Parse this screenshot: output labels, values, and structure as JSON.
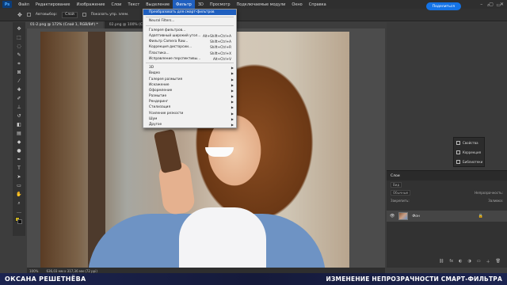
{
  "menubar": {
    "logo": "Ps",
    "items": [
      "Файл",
      "Редактирование",
      "Изображение",
      "Слои",
      "Текст",
      "Выделение",
      "Фильтр",
      "3D",
      "Просмотр",
      "Подключаемые модули",
      "Окно",
      "Справка"
    ],
    "active_index": 6
  },
  "options": {
    "autoselect": "Автовыбор:",
    "autoselect_value": "Слой",
    "show_controls": "Показать упр. элем.",
    "share": "Поделиться"
  },
  "tabs": [
    {
      "label": "01-2.png @ 172% (Слой 1, RGB/8#) *"
    },
    {
      "label": "02.png @ 100% (Слой 1, RGB/8#) *"
    }
  ],
  "filter_menu": {
    "items": [
      {
        "label": "Преобразовать для смарт-фильтров",
        "highlight": true
      },
      {
        "sep": true
      },
      {
        "label": "Neural Filters..."
      },
      {
        "sep": true
      },
      {
        "label": "Галерея фильтров..."
      },
      {
        "label": "Адаптивный широкий угол...",
        "shortcut": "Alt+Shift+Ctrl+A"
      },
      {
        "label": "Фильтр Camera Raw...",
        "shortcut": "Shift+Ctrl+A"
      },
      {
        "label": "Коррекция дисторсии...",
        "shortcut": "Shift+Ctrl+R"
      },
      {
        "label": "Пластика...",
        "shortcut": "Shift+Ctrl+X"
      },
      {
        "label": "Исправление перспективы...",
        "shortcut": "Alt+Ctrl+V"
      },
      {
        "sep": true
      },
      {
        "label": "3D",
        "submenu": true
      },
      {
        "label": "Видео",
        "submenu": true
      },
      {
        "label": "Галерея размытия",
        "submenu": true
      },
      {
        "label": "Искажение",
        "submenu": true
      },
      {
        "label": "Оформление",
        "submenu": true
      },
      {
        "label": "Размытие",
        "submenu": true
      },
      {
        "label": "Рендеринг",
        "submenu": true
      },
      {
        "label": "Стилизация",
        "submenu": true
      },
      {
        "label": "Усиление резкости",
        "submenu": true
      },
      {
        "label": "Шум",
        "submenu": true
      },
      {
        "label": "Другое",
        "submenu": true
      }
    ]
  },
  "mini_panel": [
    "Свойства",
    "Коррекция",
    "Библиотеки"
  ],
  "layers": {
    "title": "Слои",
    "search": "Вид",
    "blend": "Обычные",
    "opacity_label": "Непрозрачность:",
    "lock_label": "Закрепить:",
    "fill_label": "Заливка:",
    "layer_name": "Фон"
  },
  "status": {
    "zoom": "100%",
    "size": "636,03 мм x 317,36 мм (72 ppi)"
  },
  "caption": {
    "left": "ОКСАНА РЕШЕТНЁВА",
    "right": "ИЗМЕНЕНИЕ НЕПРОЗРАЧНОСТИ СМАРТ-ФИЛЬТРА"
  }
}
